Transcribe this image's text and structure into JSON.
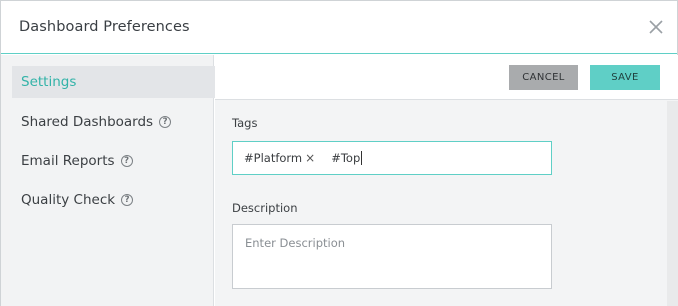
{
  "dialog": {
    "title": "Dashboard Preferences",
    "close_icon": "close-icon"
  },
  "sidebar": {
    "items": [
      {
        "label": "Settings",
        "active": true,
        "help": false
      },
      {
        "label": "Shared Dashboards",
        "active": false,
        "help": true
      },
      {
        "label": "Email Reports",
        "active": false,
        "help": true
      },
      {
        "label": "Quality Check",
        "active": false,
        "help": true
      }
    ],
    "help_glyph": "?"
  },
  "toolbar": {
    "cancel_label": "CANCEL",
    "save_label": "SAVE"
  },
  "form": {
    "tags": {
      "label": "Tags",
      "chips": [
        "#Platform"
      ],
      "remove_glyph": "×",
      "current_input": "#Top"
    },
    "description": {
      "label": "Description",
      "placeholder": "Enter Description",
      "value": ""
    }
  },
  "colors": {
    "accent": "#5fcfc6",
    "active_text": "#32b3a8",
    "cancel_bg": "#a9abad",
    "sidebar_bg": "#f2f3f4"
  }
}
